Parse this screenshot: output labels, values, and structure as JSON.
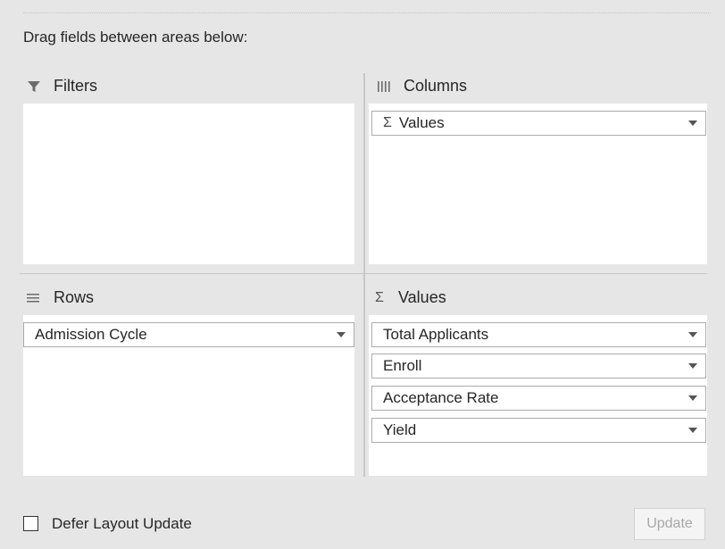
{
  "instructions": "Drag fields between areas below:",
  "areas": {
    "filters": {
      "label": "Filters",
      "icon": "filter-icon",
      "items": []
    },
    "columns": {
      "label": "Columns",
      "icon": "columns-icon",
      "items": [
        {
          "label": "Values",
          "sigma": "Σ"
        }
      ]
    },
    "rows": {
      "label": "Rows",
      "icon": "rows-icon",
      "items": [
        {
          "label": "Admission Cycle"
        }
      ]
    },
    "values": {
      "label": "Values",
      "icon": "sigma-icon",
      "sigma": "Σ",
      "items": [
        {
          "label": "Total Applicants"
        },
        {
          "label": "Enroll"
        },
        {
          "label": "Acceptance Rate"
        },
        {
          "label": "Yield"
        }
      ]
    }
  },
  "footer": {
    "defer_label": "Defer Layout Update",
    "defer_checked": false,
    "update_label": "Update"
  },
  "colors": {
    "panel_bg": "#e6e6e6",
    "area_bg": "#ffffff",
    "divider": "#c8c8c8",
    "disabled_text": "#a8a8a8"
  }
}
